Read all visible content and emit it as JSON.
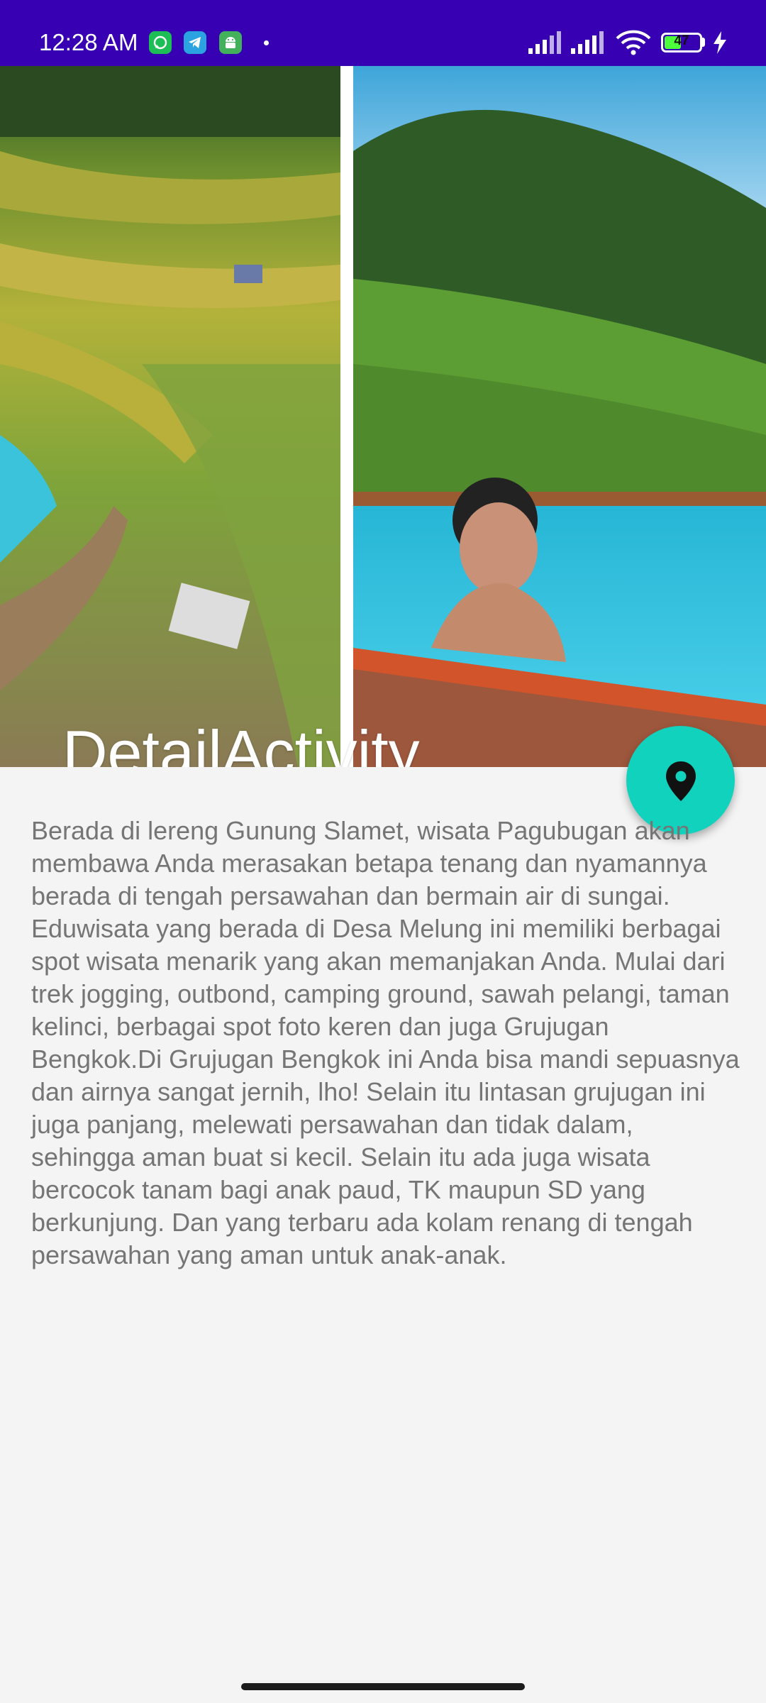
{
  "status_bar": {
    "time": "12:28 AM",
    "battery_level": "47",
    "battery_fraction": 0.47,
    "notification_icons": [
      "whatsapp-icon",
      "telegram-icon",
      "android-icon",
      "dot-icon"
    ],
    "system_icons": [
      "signal-icon",
      "signal-icon",
      "wifi-icon",
      "battery-icon",
      "charging-icon"
    ],
    "background_color": "#3700b3"
  },
  "header": {
    "title": "DetailActivity",
    "images": [
      "rice-terrace-aerial-image",
      "pool-swimmer-image"
    ]
  },
  "fab": {
    "icon": "location-pin-icon",
    "color": "#11d2bd"
  },
  "content": {
    "description": "Berada di lereng Gunung Slamet, wisata Pagubugan akan membawa Anda merasakan betapa tenang dan nyamannya berada di tengah persawahan dan bermain air di sungai. Eduwisata yang berada di Desa Melung ini memiliki berbagai spot wisata menarik yang akan memanjakan Anda. Mulai dari trek jogging, outbond, camping ground, sawah pelangi, taman kelinci, berbagai spot foto keren dan juga Grujugan Bengkok.Di Grujugan Bengkok ini Anda bisa mandi sepuasnya dan airnya sangat jernih, lho! Selain itu lintasan grujugan ini juga panjang, melewati persawahan dan tidak dalam, sehingga aman buat si kecil. Selain itu ada juga wisata bercocok tanam bagi anak paud, TK maupun SD yang berkunjung. Dan yang terbaru ada kolam renang di tengah persawahan yang aman untuk anak-anak."
  }
}
